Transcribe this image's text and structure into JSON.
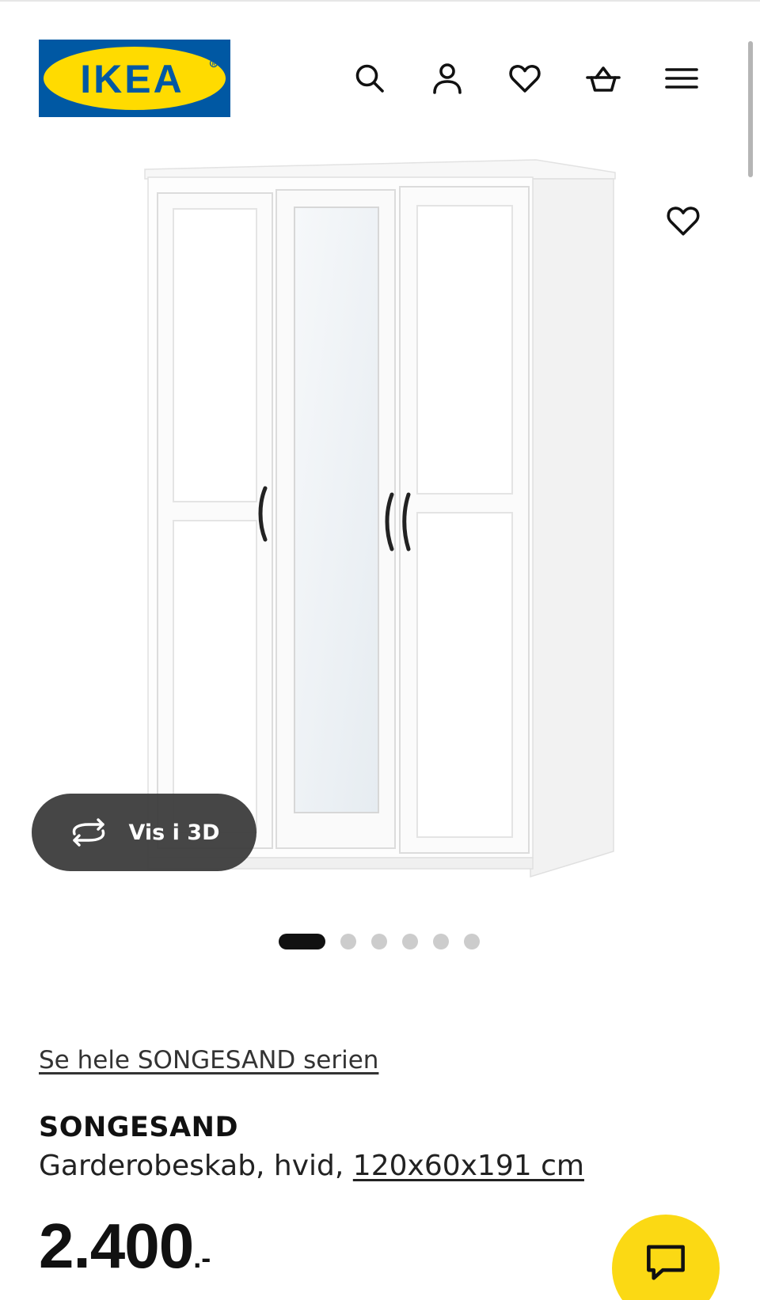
{
  "header": {
    "logo_text": "IKEA",
    "icons": [
      {
        "name": "search-icon"
      },
      {
        "name": "user-icon"
      },
      {
        "name": "heart-icon"
      },
      {
        "name": "basket-icon"
      },
      {
        "name": "menu-icon"
      }
    ]
  },
  "gallery": {
    "favorite_icon": "heart-icon",
    "vis3d_label": "Vis i 3D",
    "vis3d_icon": "rotate-3d-icon",
    "image_count": 6,
    "active_index": 0
  },
  "product": {
    "series_link": "Se hele SONGESAND serien",
    "name": "SONGESAND",
    "description": "Garderobeskab, hvid, ",
    "size": "120x60x191 cm",
    "price": "2.400",
    "price_suffix": ".-"
  },
  "chat": {
    "icon": "chat-icon"
  },
  "colors": {
    "ikea_blue": "#0058a3",
    "ikea_yellow": "#ffdb00",
    "chat_yellow": "#fbd914",
    "pill_dark": "#3a3a3a"
  }
}
